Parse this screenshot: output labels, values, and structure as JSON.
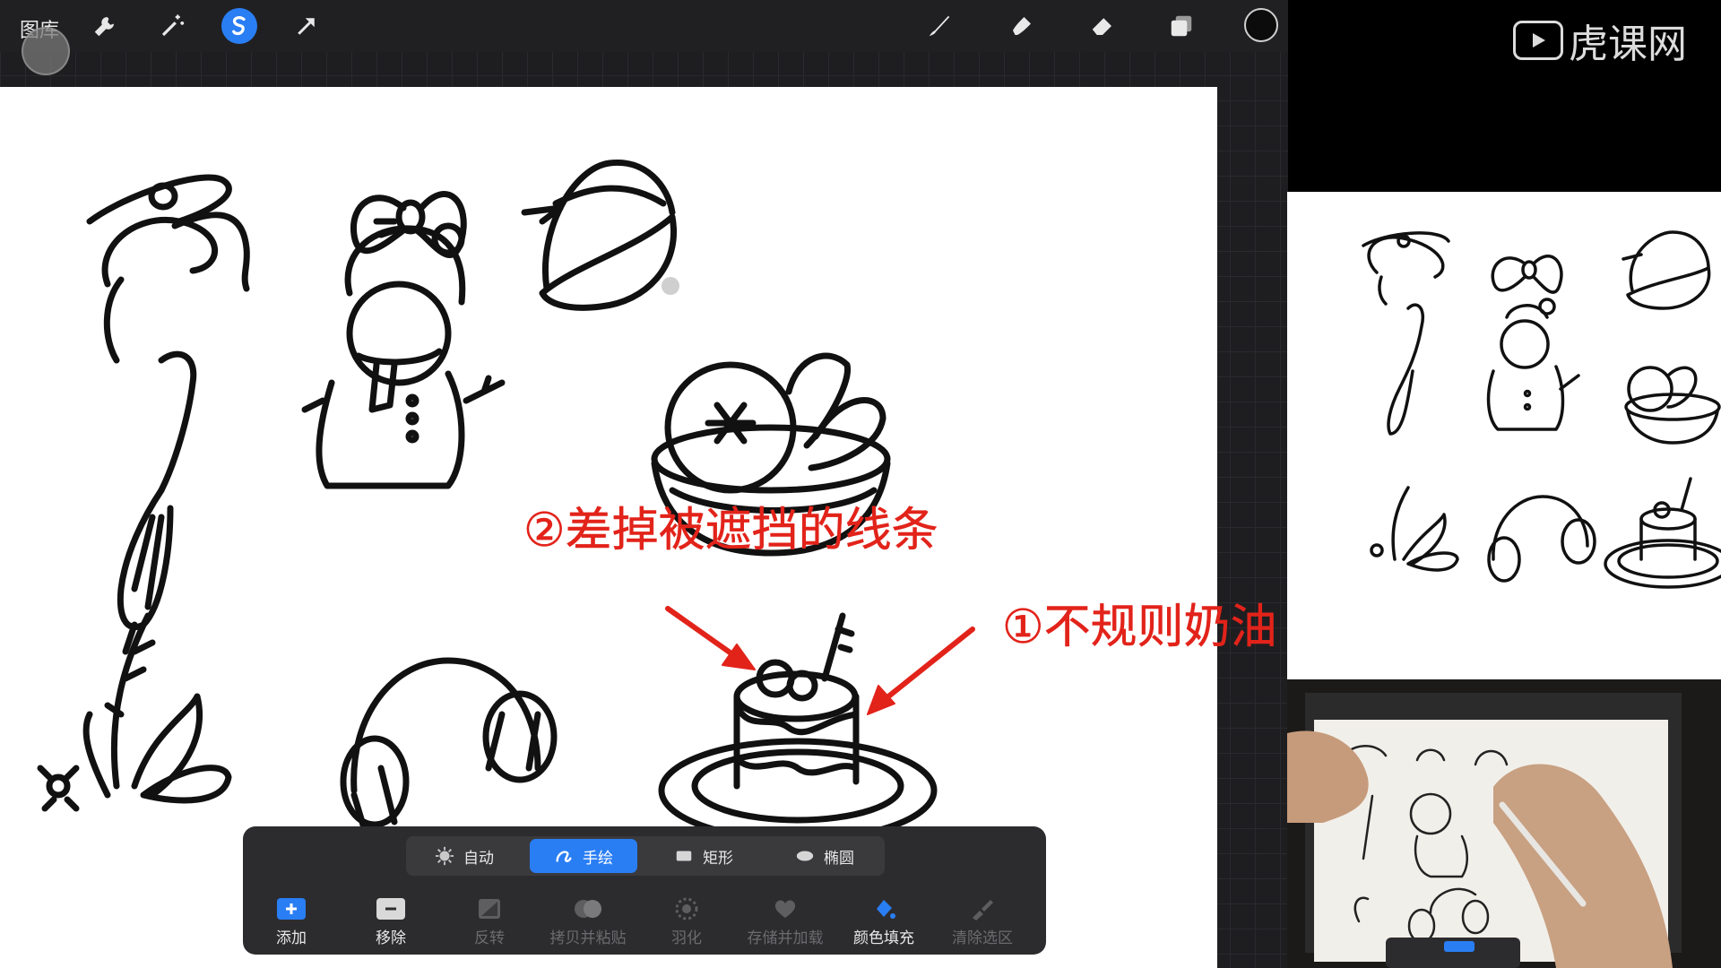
{
  "app": {
    "gallery_label": "图库",
    "toolbar_left_icons": [
      "wrench-icon",
      "magic-wand-icon",
      "selection-icon",
      "transform-arrow-icon"
    ],
    "toolbar_right_icons": [
      "brush-icon",
      "smudge-icon",
      "eraser-icon",
      "layers-icon"
    ],
    "active_tool": "selection-icon",
    "current_color": "#0c0c0c"
  },
  "annotations": {
    "note_1": "②差掉被遮挡的线条",
    "note_2": "①不规则奶油",
    "arrow_color": "#e2231a"
  },
  "selection_toolbar": {
    "modes": [
      {
        "label": "自动",
        "icon": "sun-icon"
      },
      {
        "label": "手绘",
        "icon": "freehand-icon"
      },
      {
        "label": "矩形",
        "icon": "rectangle-icon"
      },
      {
        "label": "椭圆",
        "icon": "ellipse-icon"
      }
    ],
    "active_mode": "手绘",
    "actions": [
      {
        "label": "添加",
        "icon": "plus-icon",
        "state": "normal"
      },
      {
        "label": "移除",
        "icon": "minus-icon",
        "state": "normal"
      },
      {
        "label": "反转",
        "icon": "invert-icon",
        "state": "disabled"
      },
      {
        "label": "拷贝并粘贴",
        "icon": "copy-paste-icon",
        "state": "disabled"
      },
      {
        "label": "羽化",
        "icon": "feather-icon",
        "state": "disabled"
      },
      {
        "label": "存储并加载",
        "icon": "heart-icon",
        "state": "disabled"
      },
      {
        "label": "颜色填充",
        "icon": "color-fill-icon",
        "state": "active"
      },
      {
        "label": "清除选区",
        "icon": "clear-selection-icon",
        "state": "disabled"
      }
    ],
    "accent_color": "#2a7ef4"
  },
  "watermark": {
    "text": "虎课网"
  }
}
